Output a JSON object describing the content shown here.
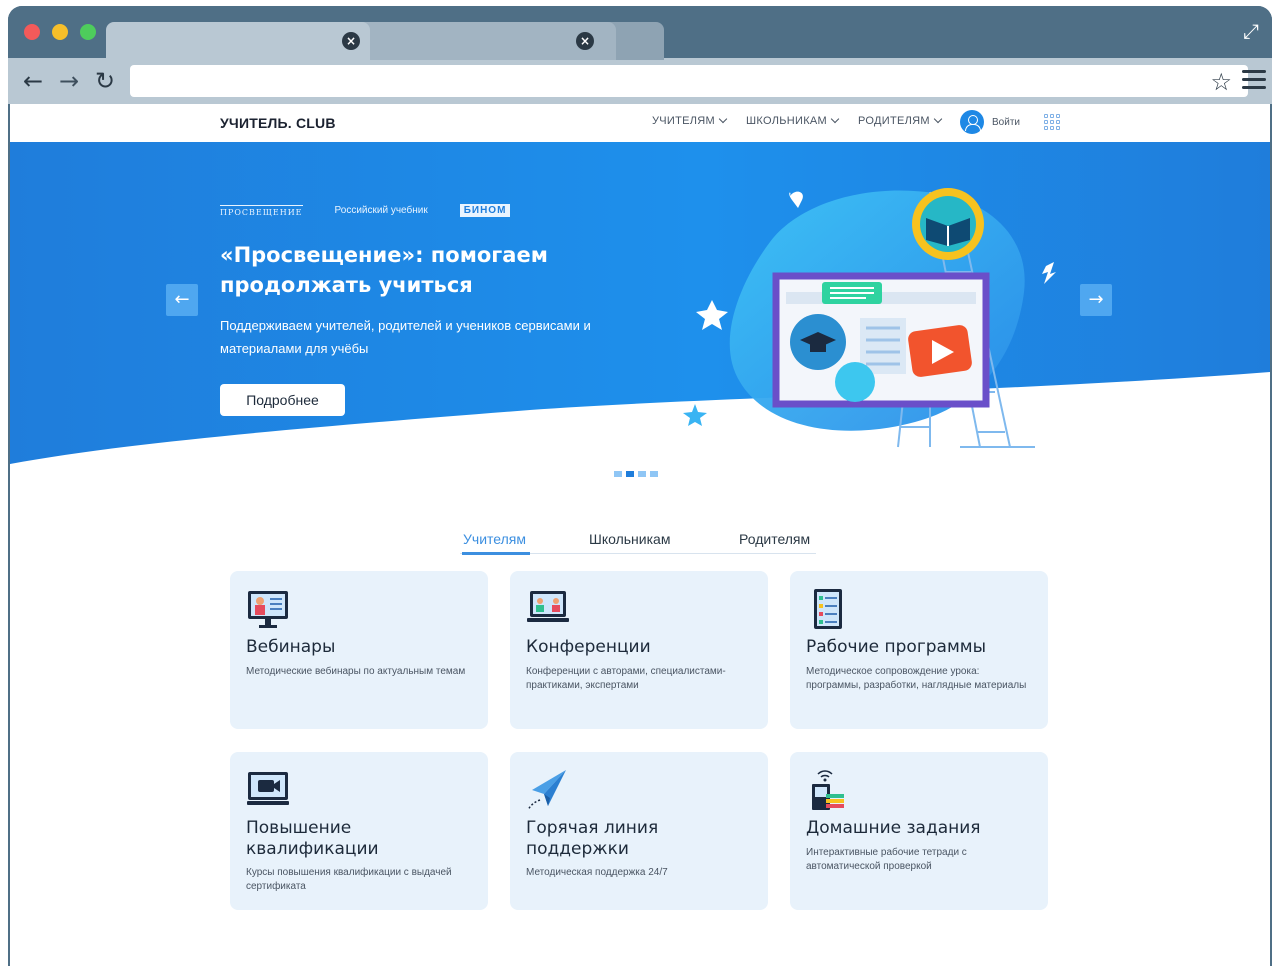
{
  "browser": {
    "tabs": [
      {
        "close_icon": "×"
      },
      {
        "close_icon": "×"
      }
    ],
    "address_value": ""
  },
  "site": {
    "logo": "УЧИТЕЛЬ. CLUB",
    "nav": [
      {
        "label": "УЧИТЕЛЯМ"
      },
      {
        "label": "ШКОЛЬНИКАМ"
      },
      {
        "label": "РОДИТЕЛЯМ"
      }
    ],
    "login_label": "Войти"
  },
  "hero": {
    "partners": [
      "ПРОСВЕЩЕНИЕ",
      "Российский учебник",
      "БИНОМ"
    ],
    "title": "«Просвещение»: помогаем продолжать учиться",
    "subtitle": "Поддерживаем учителей, родителей и учеников сервисами и материалами для учёбы",
    "button": "Подробнее",
    "slide_count": 4,
    "active_slide": 2,
    "colors": {
      "hero_blue": "#1f7ddb",
      "hero_light": "#2fa3f2"
    }
  },
  "categories": {
    "tabs": [
      "Учителям",
      "Школьникам",
      "Родителям"
    ],
    "active": "Учителям"
  },
  "cards": [
    {
      "title": "Вебинары",
      "desc": "Методические вебинары по актуальным темам",
      "icon": "webinar-icon"
    },
    {
      "title": "Конференции",
      "desc": "Конференции с авторами, специалистами-практиками, экспертами",
      "icon": "conference-icon"
    },
    {
      "title": "Рабочие программы",
      "desc": "Методическое сопровождение урока: программы, разработки, наглядные материалы",
      "icon": "programs-icon"
    },
    {
      "title": "Повышение квалификации",
      "desc": "Курсы повышения квалификации с выдачей сертификата",
      "icon": "video-screen-icon"
    },
    {
      "title": "Горячая линия поддержки",
      "desc": "Методическая поддержка 24/7",
      "icon": "paper-plane-icon"
    },
    {
      "title": "Домашние задания",
      "desc": "Интерактивные рабочие тетради с автоматической проверкой",
      "icon": "homework-icon"
    }
  ]
}
